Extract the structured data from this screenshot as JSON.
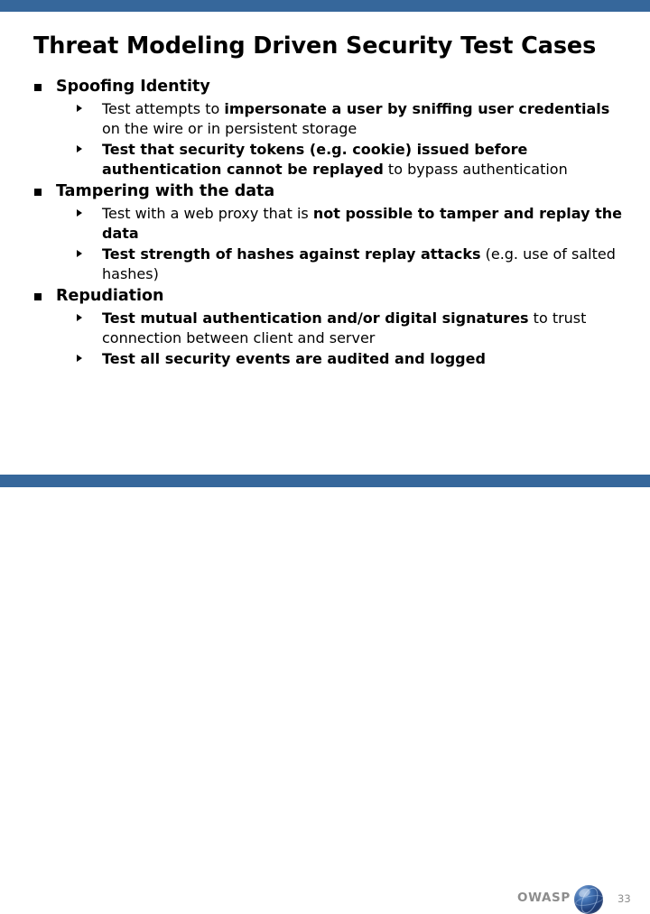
{
  "slide": {
    "title": "Threat Modeling Driven Security Test Cases",
    "page_number": "33",
    "accent_color": "#36679b",
    "text_color": "#000000",
    "footer_text_color": "#8d8d8d",
    "background_color": "#ffffff"
  },
  "footer": {
    "brand": "OWASP",
    "logo_icon": "owasp-globe-icon"
  },
  "bullets": [
    {
      "label": "Spoofing Identity",
      "marker": "square-bullet-icon",
      "children": [
        {
          "marker": "triangle-bullet-icon",
          "runs": [
            {
              "text": "Test attempts to ",
              "bold": false
            },
            {
              "text": "impersonate a user by sniffing user credentials",
              "bold": true
            },
            {
              "text": " on the wire or in persistent storage",
              "bold": false
            }
          ]
        },
        {
          "marker": "triangle-bullet-icon",
          "runs": [
            {
              "text": "Test that  security tokens (e.g. cookie) issued before authentication cannot be replayed",
              "bold": true
            },
            {
              "text": " to bypass authentication",
              "bold": false
            }
          ]
        }
      ]
    },
    {
      "label": "Tampering with the data",
      "marker": "square-bullet-icon",
      "children": [
        {
          "marker": "triangle-bullet-icon",
          "runs": [
            {
              "text": "Test with a web proxy that is ",
              "bold": false
            },
            {
              "text": "not possible to tamper and replay the data",
              "bold": true
            }
          ]
        },
        {
          "marker": "triangle-bullet-icon",
          "runs": [
            {
              "text": "Test strength of hashes against replay attacks",
              "bold": true
            },
            {
              "text": " (e.g. use of salted hashes)",
              "bold": false
            }
          ]
        }
      ]
    },
    {
      "label": "Repudiation",
      "marker": "square-bullet-icon",
      "children": [
        {
          "marker": "triangle-bullet-icon",
          "runs": [
            {
              "text": "Test mutual authentication and/or digital signatures",
              "bold": true
            },
            {
              "text": " to trust connection between client and server",
              "bold": false
            }
          ]
        },
        {
          "marker": "triangle-bullet-icon",
          "runs": [
            {
              "text": "Test all security events are audited and logged",
              "bold": true
            }
          ]
        }
      ]
    }
  ]
}
